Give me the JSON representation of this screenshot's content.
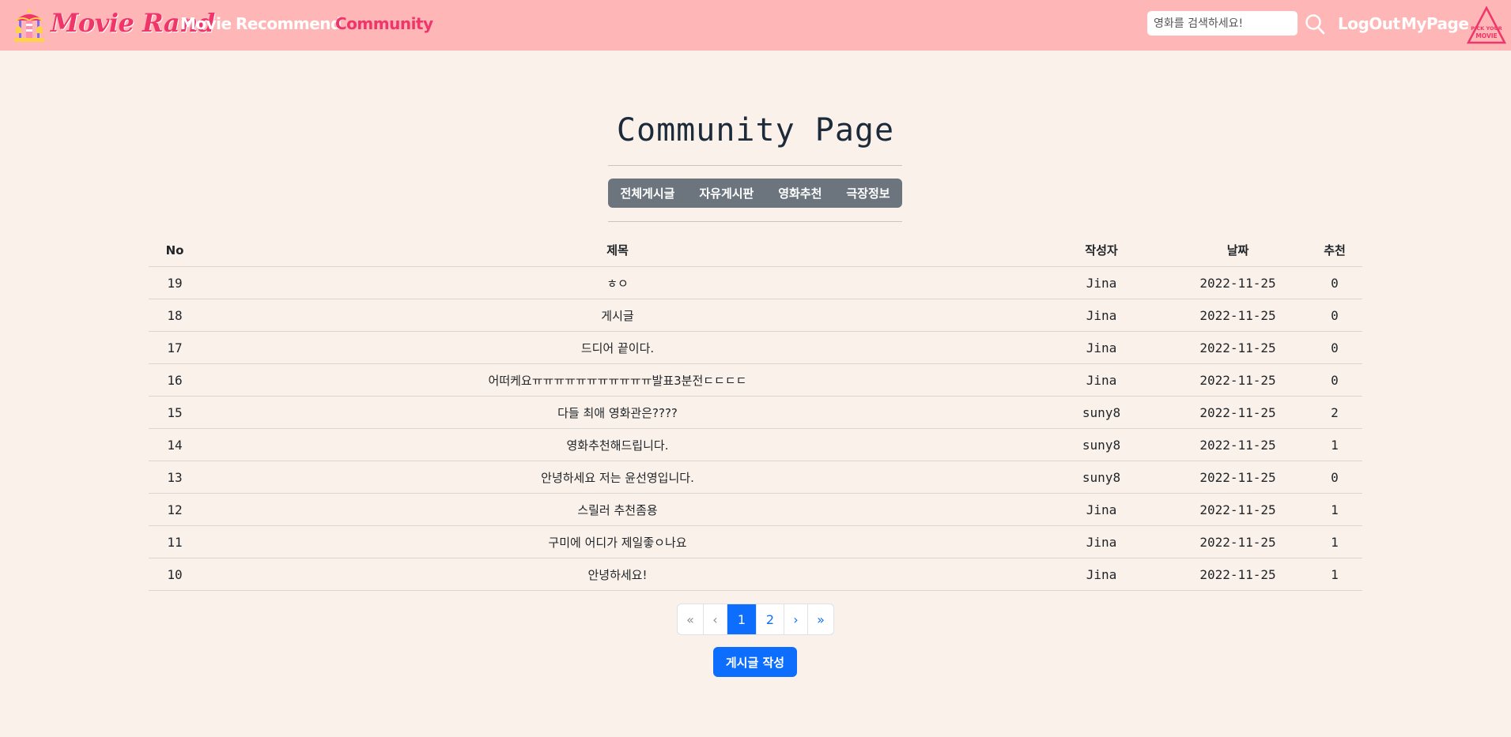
{
  "navbar": {
    "brand": "Movie Rand",
    "links": [
      "Movie",
      "Recommend",
      "Community"
    ],
    "active_link": "Community",
    "search_placeholder": "영화를 검색하세요!",
    "logout": "LogOut",
    "mypage": "MyPage",
    "pick_logo_text": "PICK YOUR MOVIE",
    "accent_color": "#f0356a",
    "bar_color": "#ffb6b6"
  },
  "page": {
    "title": "Community Page",
    "categories": [
      "전체게시글",
      "자유게시판",
      "영화추천",
      "극장정보"
    ]
  },
  "table": {
    "headers": {
      "no": "No",
      "title": "제목",
      "author": "작성자",
      "date": "날짜",
      "rec": "추천"
    },
    "rows": [
      {
        "no": "19",
        "title": "ㅎㅇ",
        "author": "Jina",
        "date": "2022-11-25",
        "rec": "0"
      },
      {
        "no": "18",
        "title": "게시글",
        "author": "Jina",
        "date": "2022-11-25",
        "rec": "0"
      },
      {
        "no": "17",
        "title": "드디어 끝이다.",
        "author": "Jina",
        "date": "2022-11-25",
        "rec": "0"
      },
      {
        "no": "16",
        "title": "어떠케요ㅠㅠㅠㅠㅠㅠㅠㅠㅠㅠㅠ발표3분전ㄷㄷㄷㄷ",
        "author": "Jina",
        "date": "2022-11-25",
        "rec": "0"
      },
      {
        "no": "15",
        "title": "다들 최애 영화관은????",
        "author": "suny8",
        "date": "2022-11-25",
        "rec": "2"
      },
      {
        "no": "14",
        "title": "영화추천해드립니다.",
        "author": "suny8",
        "date": "2022-11-25",
        "rec": "1"
      },
      {
        "no": "13",
        "title": "안녕하세요 저는 윤선영입니다.",
        "author": "suny8",
        "date": "2022-11-25",
        "rec": "0"
      },
      {
        "no": "12",
        "title": "스릴러 추천좀용",
        "author": "Jina",
        "date": "2022-11-25",
        "rec": "1"
      },
      {
        "no": "11",
        "title": "구미에 어디가 제일좋ㅇ나요",
        "author": "Jina",
        "date": "2022-11-25",
        "rec": "1"
      },
      {
        "no": "10",
        "title": "안녕하세요!",
        "author": "Jina",
        "date": "2022-11-25",
        "rec": "1"
      }
    ]
  },
  "pagination": {
    "first": "«",
    "prev": "‹",
    "pages": [
      "1",
      "2"
    ],
    "current": "1",
    "next": "›",
    "last": "»"
  },
  "write_button": "게시글 작성"
}
